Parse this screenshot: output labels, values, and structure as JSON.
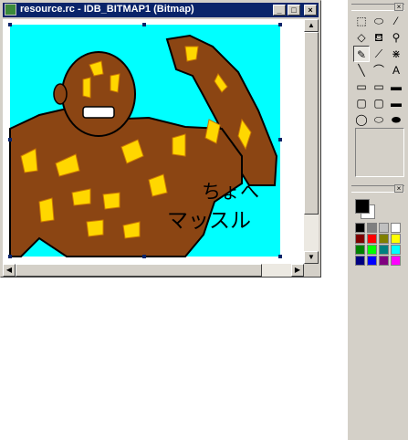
{
  "window": {
    "title": "resource.rc - IDB_BITMAP1 (Bitmap)",
    "minimize_glyph": "_",
    "maximize_glyph": "□",
    "close_glyph": "×"
  },
  "bitmap": {
    "caption_line1": "ちょへ",
    "caption_line2": "マッスル",
    "colors": {
      "background": "#00ffff",
      "skin": "#8b4513",
      "highlight": "#ffd700",
      "outline": "#000000"
    }
  },
  "toolbox": {
    "close_glyph": "×",
    "tools": [
      {
        "name": "free-select-icon",
        "glyph": "⬚"
      },
      {
        "name": "rect-select-icon",
        "glyph": "⬭"
      },
      {
        "name": "dropper-icon",
        "glyph": "⁄"
      },
      {
        "name": "eraser-icon",
        "glyph": "◇"
      },
      {
        "name": "fill-icon",
        "glyph": "⛾"
      },
      {
        "name": "magnifier-icon",
        "glyph": "⚲"
      },
      {
        "name": "pencil-icon",
        "glyph": "✎"
      },
      {
        "name": "brush-icon",
        "glyph": "⟋"
      },
      {
        "name": "airbrush-icon",
        "glyph": "⋇"
      },
      {
        "name": "line-icon",
        "glyph": "╲"
      },
      {
        "name": "curve-icon",
        "glyph": "⌒"
      },
      {
        "name": "text-icon",
        "glyph": "A"
      },
      {
        "name": "rect-outline-icon",
        "glyph": "▭"
      },
      {
        "name": "rect-fill-outline-icon",
        "glyph": "▭"
      },
      {
        "name": "rect-filled-icon",
        "glyph": "▬"
      },
      {
        "name": "roundrect-outline-icon",
        "glyph": "▢"
      },
      {
        "name": "roundrect-fill-outline-icon",
        "glyph": "▢"
      },
      {
        "name": "roundrect-filled-icon",
        "glyph": "▬"
      },
      {
        "name": "ellipse-outline-icon",
        "glyph": "◯"
      },
      {
        "name": "ellipse-fill-outline-icon",
        "glyph": "⬭"
      },
      {
        "name": "ellipse-filled-icon",
        "glyph": "⬬"
      }
    ]
  },
  "palette": {
    "foreground": "#000000",
    "background": "#ffffff",
    "colors": [
      "#000000",
      "#808080",
      "#c0c0c0",
      "#ffffff",
      "#800000",
      "#ff0000",
      "#808000",
      "#ffff00",
      "#008000",
      "#00ff00",
      "#008080",
      "#00ffff",
      "#000080",
      "#0000ff",
      "#800080",
      "#ff00ff"
    ]
  }
}
